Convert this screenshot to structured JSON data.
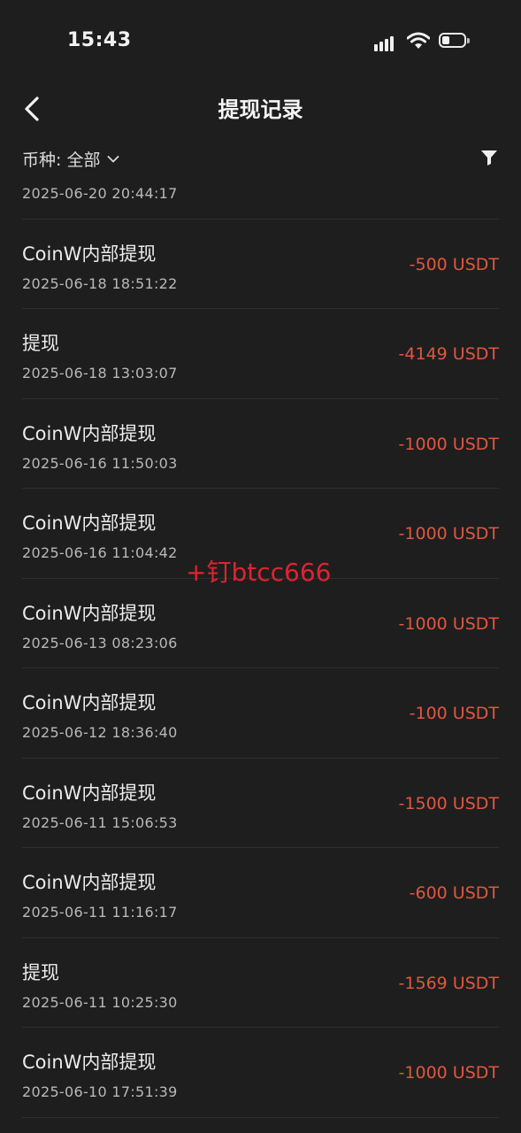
{
  "status_bar": {
    "time": "15:43",
    "battery_level": 0.3
  },
  "header": {
    "title": "提现记录",
    "back_icon": "chevron-left-icon"
  },
  "filter": {
    "currency_label": "币种: 全部",
    "dropdown_icon": "chevron-down-icon",
    "filter_icon": "funnel-icon"
  },
  "records": [
    {
      "type": "",
      "date": "2025-06-20 20:44:17",
      "amount": ""
    },
    {
      "type": "CoinW内部提现",
      "date": "2025-06-18 18:51:22",
      "amount": "-500 USDT"
    },
    {
      "type": "提现",
      "date": "2025-06-18 13:03:07",
      "amount": "-4149 USDT"
    },
    {
      "type": "CoinW内部提现",
      "date": "2025-06-16 11:50:03",
      "amount": "-1000 USDT"
    },
    {
      "type": "CoinW内部提现",
      "date": "2025-06-16 11:04:42",
      "amount": "-1000 USDT"
    },
    {
      "type": "CoinW内部提现",
      "date": "2025-06-13 08:23:06",
      "amount": "-1000 USDT"
    },
    {
      "type": "CoinW内部提现",
      "date": "2025-06-12 18:36:40",
      "amount": "-100 USDT"
    },
    {
      "type": "CoinW内部提现",
      "date": "2025-06-11 15:06:53",
      "amount": "-1500 USDT"
    },
    {
      "type": "CoinW内部提现",
      "date": "2025-06-11 11:16:17",
      "amount": "-600 USDT"
    },
    {
      "type": "提现",
      "date": "2025-06-11 10:25:30",
      "amount": "-1569 USDT"
    },
    {
      "type": "CoinW内部提现",
      "date": "2025-06-10 17:51:39",
      "amount": "-1000 USDT"
    }
  ],
  "watermark": "+钉btcc666",
  "colors": {
    "background": "#1e1e1f",
    "amount": "#e0573e",
    "watermark": "#e0232e",
    "divider": "#2f2f31"
  }
}
